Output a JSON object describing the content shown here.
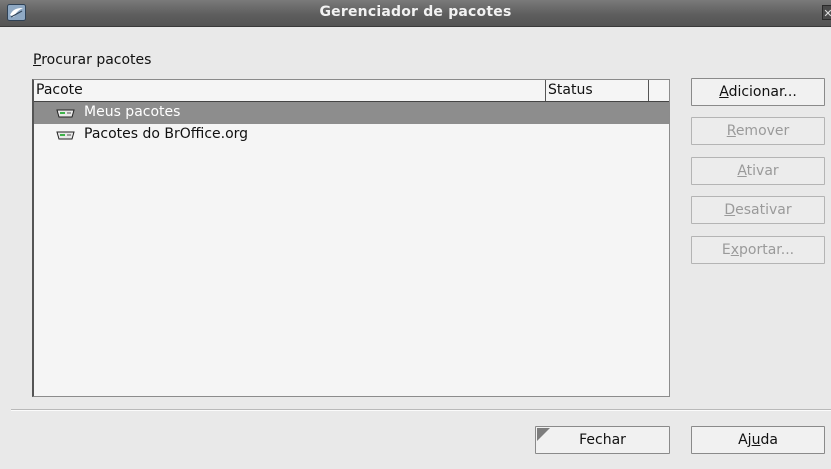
{
  "window": {
    "title": "Gerenciador de pacotes"
  },
  "browse_label_mnemonic": "P",
  "browse_label_rest": "rocurar pacotes",
  "list": {
    "columns": [
      "Pacote",
      "Status",
      ""
    ],
    "rows": [
      {
        "label": "Meus pacotes",
        "status": "",
        "selected": true
      },
      {
        "label": "Pacotes do BrOffice.org",
        "status": "",
        "selected": false
      }
    ]
  },
  "side_buttons": {
    "add": {
      "mnemonic": "A",
      "rest": "dicionar...",
      "enabled": true
    },
    "remove": {
      "mnemonic": "R",
      "rest": "emover",
      "enabled": false
    },
    "enable": {
      "mnemonic": "A",
      "rest": "tivar",
      "enabled": false
    },
    "disable": {
      "mnemonic": "D",
      "rest": "esativar",
      "enabled": false
    },
    "export": {
      "before": "E",
      "mnemonic": "x",
      "rest": "portar...",
      "enabled": false
    }
  },
  "bottom_buttons": {
    "close": "Fechar",
    "help_before": "Aj",
    "help_mnemonic": "u",
    "help_rest": "da"
  },
  "colors": {
    "titlebar": "#5e5e5e",
    "selection": "#8d8d8d",
    "dialog_bg": "#e9e9e9"
  },
  "icons": {
    "app": "broffice-app-icon",
    "package": "package-drive-icon",
    "close": "window-close-icon"
  }
}
